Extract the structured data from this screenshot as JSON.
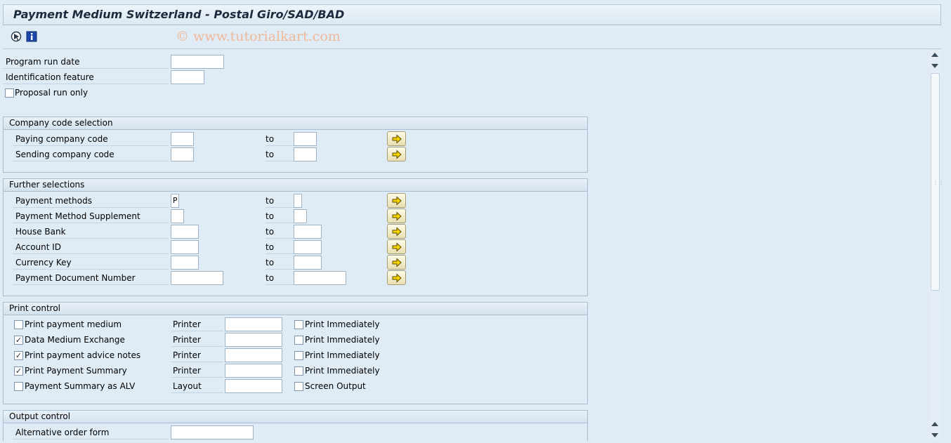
{
  "window": {
    "title": "Payment Medium Switzerland - Postal Giro/SAD/BAD",
    "watermark": "© www.tutorialkart.com"
  },
  "toolbar": {
    "execute_icon": "execute-icon",
    "info_icon": "info-icon"
  },
  "top_fields": {
    "program_run_date": {
      "label": "Program run date",
      "value": ""
    },
    "identification_feature": {
      "label": "Identification feature",
      "value": ""
    },
    "proposal_run_only": {
      "label": "Proposal run only",
      "checked": false
    }
  },
  "company_code_selection": {
    "title": "Company code selection",
    "rows": [
      {
        "label": "Paying company code",
        "from": "",
        "to_label": "to",
        "to": ""
      },
      {
        "label": "Sending company code",
        "from": "",
        "to_label": "to",
        "to": ""
      }
    ]
  },
  "further_selections": {
    "title": "Further selections",
    "rows": [
      {
        "label": "Payment methods",
        "from": "P",
        "to_label": "to",
        "to": ""
      },
      {
        "label": "Payment Method Supplement",
        "from": "",
        "to_label": "to",
        "to": ""
      },
      {
        "label": "House Bank",
        "from": "",
        "to_label": "to",
        "to": ""
      },
      {
        "label": "Account ID",
        "from": "",
        "to_label": "to",
        "to": ""
      },
      {
        "label": "Currency Key",
        "from": "",
        "to_label": "to",
        "to": ""
      },
      {
        "label": "Payment Document Number",
        "from": "",
        "to_label": "to",
        "to": ""
      }
    ]
  },
  "print_control": {
    "title": "Print control",
    "rows": [
      {
        "label": "Print payment medium",
        "checked": false,
        "device_label": "Printer",
        "device": "",
        "opt_label": "Print Immediately",
        "opt_checked": false
      },
      {
        "label": "Data Medium Exchange",
        "checked": true,
        "device_label": "Printer",
        "device": "",
        "opt_label": "Print Immediately",
        "opt_checked": false
      },
      {
        "label": "Print payment advice notes",
        "checked": true,
        "device_label": "Printer",
        "device": "",
        "opt_label": "Print Immediately",
        "opt_checked": false
      },
      {
        "label": "Print Payment Summary",
        "checked": true,
        "device_label": "Printer",
        "device": "",
        "opt_label": "Print Immediately",
        "opt_checked": false
      },
      {
        "label": "Payment Summary as ALV",
        "checked": false,
        "device_label": "Layout",
        "device": "",
        "opt_label": "Screen Output",
        "opt_checked": false
      }
    ]
  },
  "output_control": {
    "title": "Output control",
    "rows": [
      {
        "label": "Alternative order form",
        "value": ""
      }
    ]
  },
  "colors": {
    "background": "#dfebf5",
    "group_border": "#a7bdd2",
    "title_text": "#1b2a3c",
    "watermark": "#f0b899",
    "arrow_button": "#f4e9a8"
  }
}
